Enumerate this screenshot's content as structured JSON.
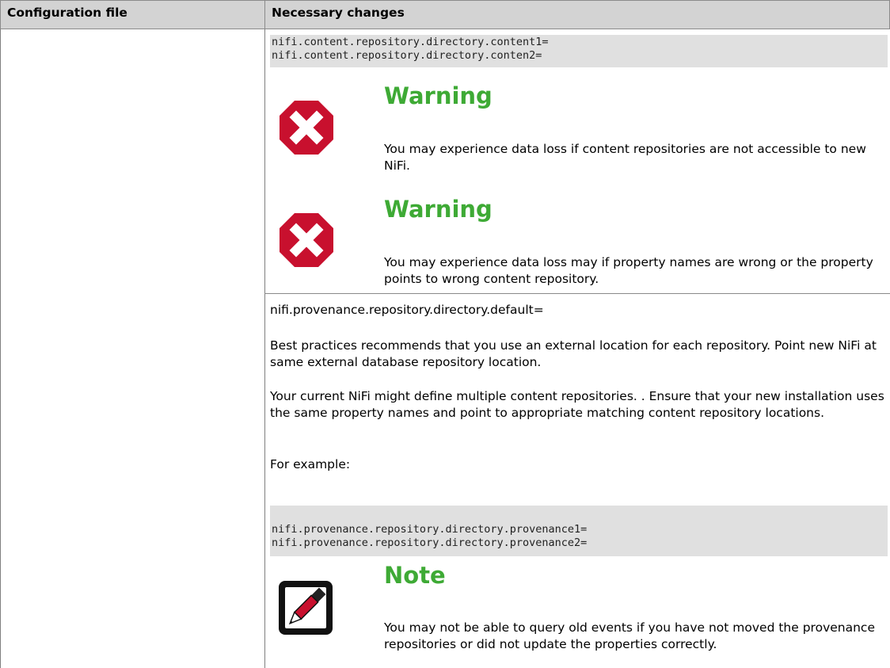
{
  "table": {
    "headers": [
      "Configuration file",
      "Necessary changes"
    ]
  },
  "content_repo": {
    "code_lines": [
      "nifi.content.repository.directory.content1=",
      "nifi.content.repository.directory.conten2="
    ],
    "warnings": [
      {
        "title": "Warning",
        "text": "You may experience data loss if content repositories are not accessible to new NiFi.",
        "icon": "error-x-icon"
      },
      {
        "title": "Warning",
        "text": "You may experience data loss may if property names are wrong or the property points to wrong content repository.",
        "icon": "error-x-icon"
      }
    ]
  },
  "provenance_repo": {
    "property": "nifi.provenance.repository.directory.default=",
    "para1": "Best practices recommends that you use an external location for each repository. Point new NiFi at same external database repository location.",
    "para2": "Your current NiFi might define multiple content repositories. . Ensure that your new installation uses the same property names and point to appropriate matching content repository locations.",
    "para3": "For example:",
    "code_lines": [
      "nifi.provenance.repository.directory.provenance1=",
      "nifi.provenance.repository.directory.provenance2="
    ],
    "note": {
      "title": "Note",
      "text": "You may not be able to query old events if you have not moved the provenance repositories or did not update the properties correctly.",
      "icon": "pencil-note-icon"
    }
  },
  "colors": {
    "header_bg": "#d3d3d3",
    "code_bg": "#e0e0e0",
    "admonition_title": "#3eaa35",
    "warning_icon": "#c8102e"
  }
}
